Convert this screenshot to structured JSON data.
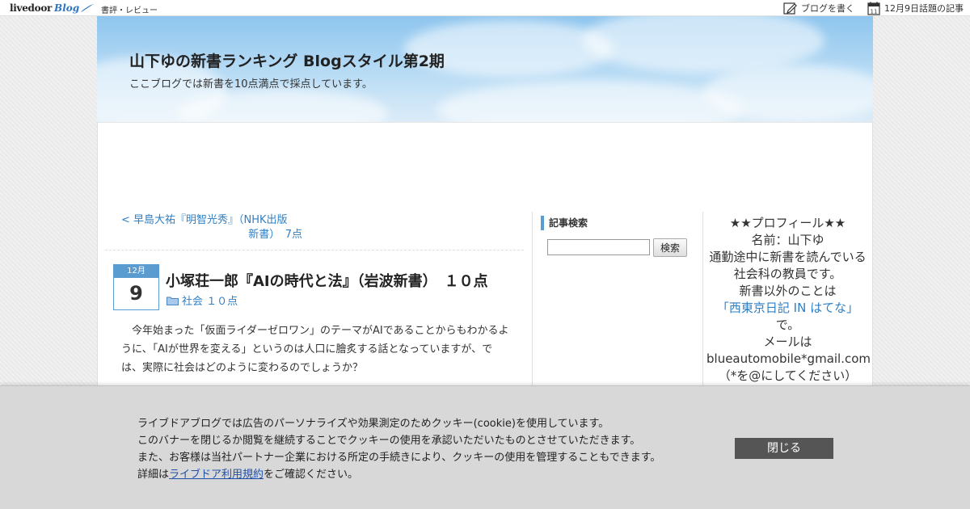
{
  "topbar": {
    "logo_text": "livedoor",
    "logo_blog": "Blog",
    "category": "書評・レビュー",
    "write_label": "ブログを書く",
    "calendar_day": "11",
    "topics_label": "12月9日話題の記事"
  },
  "header": {
    "title": "山下ゆの新書ランキング Blogスタイル第2期",
    "description": "ここブログでは新書を10点満点で採点しています。"
  },
  "post": {
    "prev_link_line1": "< 早島大祐『明智光秀』（NHK出版",
    "prev_link_line2": "新書）　7点",
    "month": "12月",
    "day": "9",
    "title": "小塚荘一郎『AIの時代と法』（岩波新書）　１０点",
    "category": "社会 １０点",
    "body_line1": "今年始まった「仮面ライダーゼロワン」のテーマがAIであることからもわかるように、「AIが世界を変える」というのは人口に膾炙する話となっていますが、では、実際に社会はどのように変わるのでしょうか？"
  },
  "search": {
    "heading": "記事検索",
    "input_value": "",
    "button_label": "検索"
  },
  "profile": {
    "heading": "★★プロフィール★★",
    "name": "名前：山下ゆ",
    "line1": "通勤途中に新書を読んでいる社会科の教員です。",
    "line2": "新書以外のことは",
    "link": "「西東京日記 IN はてな」",
    "line3": "で。",
    "line4": "メールはblueautomobile*gmail.com（*を@にしてください）"
  },
  "cookie": {
    "line1": "ライブドアブログでは広告のパーソナライズや効果測定のためクッキー(cookie)を使用しています。",
    "line2": "このバナーを閉じるか閲覧を継続することでクッキーの使用を承認いただいたものとさせていただきます。",
    "line3": "また、お客様は当社パートナー企業における所定の手続きにより、クッキーの使用を管理することもできます。",
    "line4_prefix": "詳細は",
    "line4_link": "ライブドア利用規約",
    "line4_suffix": "をご確認ください。",
    "close_label": "閉じる"
  },
  "colors": {
    "accent": "#5a9bd0",
    "link": "#2f7fc4",
    "banner_bg": "#d8d8d8",
    "close_btn": "#555555"
  }
}
